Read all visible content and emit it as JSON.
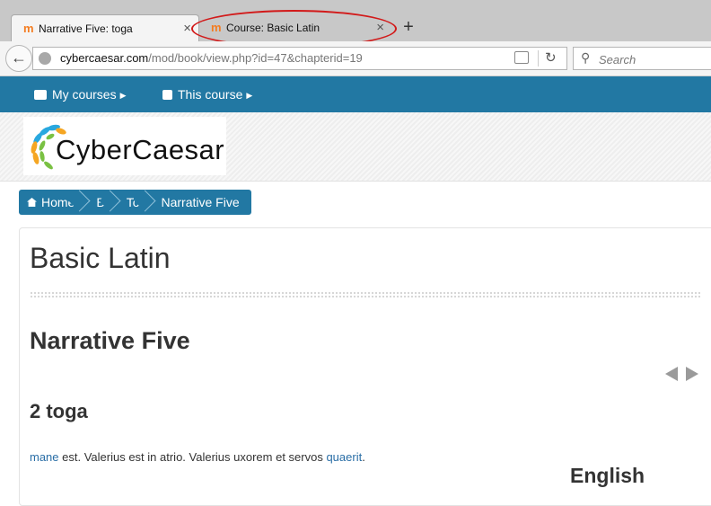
{
  "browser": {
    "tabs": [
      {
        "title": "Narrative Five: toga",
        "active": true
      },
      {
        "title": "Course: Basic Latin",
        "active": false
      }
    ],
    "new_tab": "+",
    "close_glyph": "×",
    "url_host": "cybercaesar.com",
    "url_path": "/mod/book/view.php?id=47&chapterid=19",
    "search_placeholder": "Search",
    "highlight_color": "#d21a1a"
  },
  "site": {
    "nav": {
      "my_courses": "My courses",
      "this_course": "This course"
    },
    "logo_text": "CyberCaesar",
    "brand_color": "#2278a3",
    "breadcrumb": [
      "Home",
      "B",
      "To",
      "Narrative Five"
    ]
  },
  "content": {
    "course_title": "Basic Latin",
    "chapter_title": "Narrative Five",
    "section_title": "2 toga",
    "para": {
      "link1": "mane",
      "text": " est. Valerius est in atrio. Valerius uxorem et servos ",
      "link2": "quaerit",
      "end": "."
    },
    "side_heading": "English"
  }
}
